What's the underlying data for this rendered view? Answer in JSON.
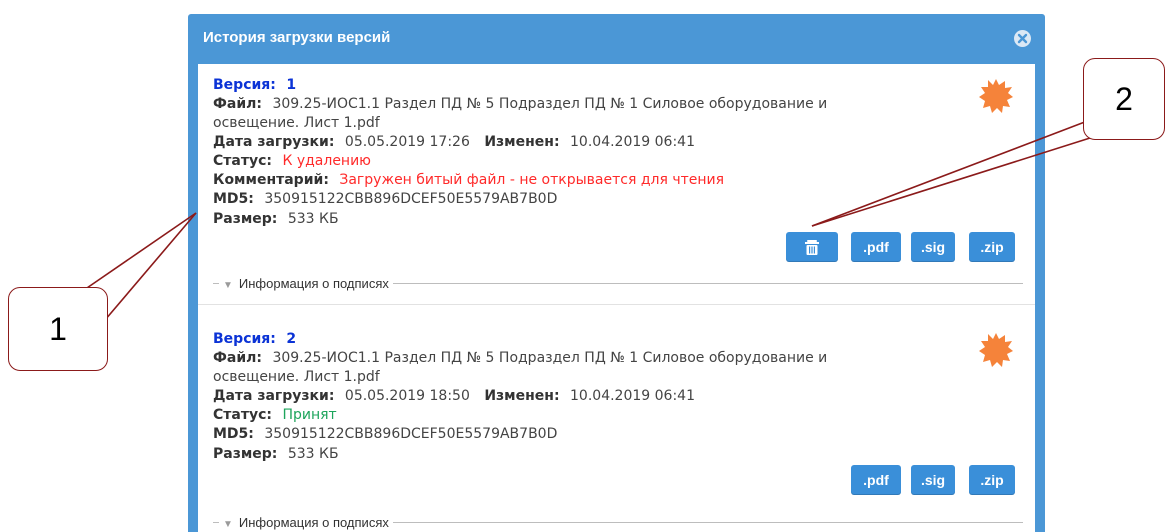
{
  "dialog": {
    "title": "История загрузки версий"
  },
  "labels": {
    "version": "Версия:",
    "file": "Файл:",
    "upload_date": "Дата загрузки:",
    "modified": "Изменен:",
    "status": "Статус:",
    "comment": "Комментарий:",
    "md5": "MD5:",
    "size": "Размер:",
    "signatures_info": "Информация о подписях"
  },
  "versions": [
    {
      "number": "1",
      "file_line1": "309.25-ИОС1.1 Раздел ПД № 5 Подраздел ПД № 1 Силовое оборудование и",
      "file_line2": "освещение. Лист 1.pdf",
      "upload_date": "05.05.2019 17:26",
      "modified": "10.04.2019 06:41",
      "status": "К удалению",
      "comment": "Загружен битый файл - не открывается для чтения",
      "md5": "350915122CBB896DCEF50E5579AB7B0D",
      "size": "533 КБ",
      "buttons": [
        ".pdf",
        ".sig",
        ".zip"
      ]
    },
    {
      "number": "2",
      "file_line1": "309.25-ИОС1.1 Раздел ПД № 5 Подраздел ПД № 1 Силовое оборудование и",
      "file_line2": "освещение. Лист 1.pdf",
      "upload_date": "05.05.2019 18:50",
      "modified": "10.04.2019 06:41",
      "status": "Принят",
      "md5": "350915122CBB896DCEF50E5579AB7B0D",
      "size": "533 КБ",
      "buttons": [
        ".pdf",
        ".sig",
        ".zip"
      ]
    }
  ],
  "callouts": {
    "one": "1",
    "two": "2"
  },
  "colors": {
    "header": "#4b97d6",
    "button": "#3a8fd9",
    "version_title": "#0b33d6",
    "status_delete": "#ff2a2a",
    "status_accepted": "#1da55c",
    "burst": "#f5833a",
    "callout_border": "#8b1a1a"
  },
  "icons": {
    "close": "close-circle-icon",
    "trash": "trash-icon",
    "status_burst": "status-burst-icon",
    "expand": "triangle-down-icon"
  }
}
